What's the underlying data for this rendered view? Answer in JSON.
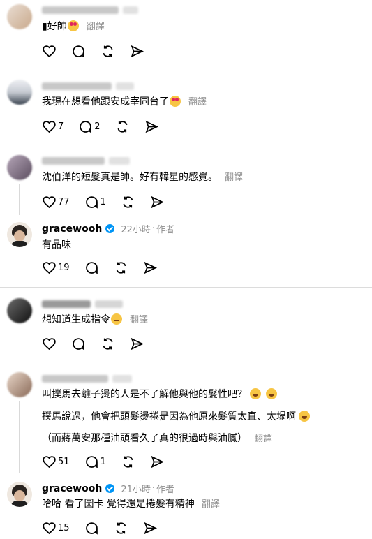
{
  "translate_label": "翻譯",
  "posts": [
    {
      "text": "▮好帥",
      "emoji": "love",
      "counts": {
        "like": "",
        "reply": ""
      }
    },
    {
      "text": "我現在想看他跟安成宰同台了",
      "emoji": "love",
      "counts": {
        "like": "7",
        "reply": "2"
      }
    },
    {
      "text": "沈伯洋的短髮真是帥。好有韓星的感覺。",
      "emoji": "",
      "counts": {
        "like": "77",
        "reply": "1"
      }
    },
    {
      "author": "gracewooh",
      "time": "22小時",
      "role": "作者",
      "text": "有品味",
      "counts": {
        "like": "19",
        "reply": ""
      }
    },
    {
      "text": "想知道生成指令",
      "emoji": "think",
      "counts": {
        "like": "",
        "reply": ""
      }
    },
    {
      "text_lines": [
        "叫撲馬去離子燙的人是不了解他與他的髮性吧？",
        "撲馬說過，他會把頭髮燙捲是因為他原來髮質太直、太塌啊",
        "（而蔣萬安那種油頭看久了真的很過時與油膩）"
      ],
      "counts": {
        "like": "51",
        "reply": "1"
      }
    },
    {
      "author": "gracewooh",
      "time": "21小時",
      "role": "作者",
      "text": "哈哈 看了圖卡 覺得還是捲髮有精神",
      "counts": {
        "like": "15",
        "reply": ""
      }
    }
  ],
  "icons": {
    "like": "heart-icon",
    "reply": "comment-icon",
    "repost": "repost-icon",
    "share": "send-icon"
  },
  "colors": {
    "verified": "#0095f6",
    "muted": "#8e8e8e",
    "divider": "#dcdcdc"
  }
}
